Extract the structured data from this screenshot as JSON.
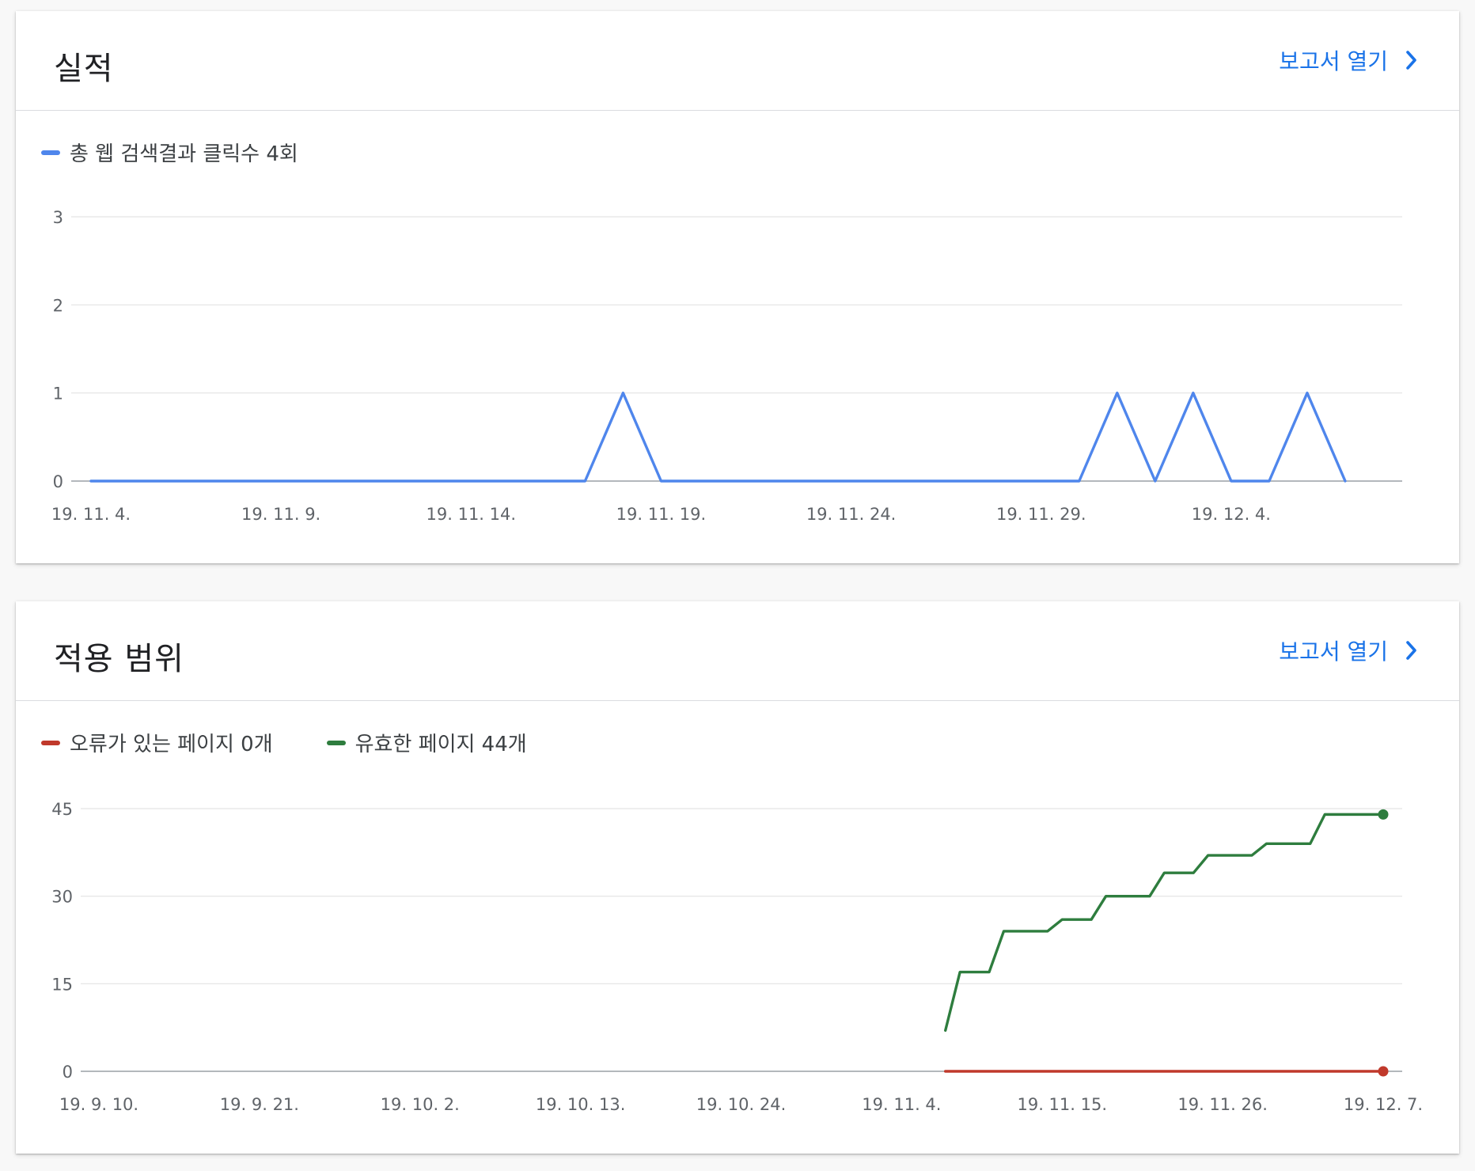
{
  "cards": [
    {
      "title": "실적",
      "link_label": "보고서 열기",
      "legend": [
        {
          "label": "총 웹 검색결과 클릭수 4회",
          "color": "#4f86ec"
        }
      ]
    },
    {
      "title": "적용 범위",
      "link_label": "보고서 열기",
      "legend": [
        {
          "label": "오류가 있는 페이지 0개",
          "color": "#c0392b"
        },
        {
          "label": "유효한 페이지 44개",
          "color": "#2e7d3e"
        }
      ]
    }
  ],
  "chart_data": [
    {
      "type": "line",
      "legend_placement": "top-left",
      "grid": true,
      "ylim": [
        0,
        3
      ],
      "yticks": [
        0,
        1,
        2,
        3
      ],
      "x": [
        "19. 11. 4.",
        "19. 11. 5.",
        "19. 11. 6.",
        "19. 11. 7.",
        "19. 11. 8.",
        "19. 11. 9.",
        "19. 11. 10.",
        "19. 11. 11.",
        "19. 11. 12.",
        "19. 11. 13.",
        "19. 11. 14.",
        "19. 11. 15.",
        "19. 11. 16.",
        "19. 11. 17.",
        "19. 11. 18.",
        "19. 11. 19.",
        "19. 11. 20.",
        "19. 11. 21.",
        "19. 11. 22.",
        "19. 11. 23.",
        "19. 11. 24.",
        "19. 11. 25.",
        "19. 11. 26.",
        "19. 11. 27.",
        "19. 11. 28.",
        "19. 11. 29.",
        "19. 11. 30.",
        "19. 12. 1.",
        "19. 12. 2.",
        "19. 12. 3.",
        "19. 12. 4.",
        "19. 12. 5.",
        "19. 12. 6.",
        "19. 12. 7.",
        "19. 12. 8."
      ],
      "xticks": [
        "19. 11. 4.",
        "19. 11. 9.",
        "19. 11. 14.",
        "19. 11. 19.",
        "19. 11. 24.",
        "19. 11. 29.",
        "19. 12. 4."
      ],
      "series": [
        {
          "name": "총 웹 검색결과 클릭수 4회",
          "color": "#4f86ec",
          "values": [
            0,
            0,
            0,
            0,
            0,
            0,
            0,
            0,
            0,
            0,
            0,
            0,
            0,
            0,
            1,
            0,
            0,
            0,
            0,
            0,
            0,
            0,
            0,
            0,
            0,
            0,
            0,
            1,
            0,
            1,
            0,
            0,
            1,
            0
          ]
        }
      ]
    },
    {
      "type": "line",
      "legend_placement": "top-left",
      "grid": true,
      "ylim": [
        0,
        45
      ],
      "yticks": [
        0,
        15,
        30,
        45
      ],
      "x_range": [
        "19. 9. 10.",
        "19. 12. 7."
      ],
      "xticks": [
        "19. 9. 10.",
        "19. 9. 21.",
        "19. 10. 2.",
        "19. 10. 13.",
        "19. 10. 24.",
        "19. 11. 4.",
        "19. 11. 15.",
        "19. 11. 26.",
        "19. 12. 7."
      ],
      "series": [
        {
          "name": "오류가 있는 페이지 0개",
          "color": "#c0392b",
          "points": [
            [
              "19. 11. 7.",
              0
            ],
            [
              "19. 12. 7.",
              0
            ]
          ]
        },
        {
          "name": "유효한 페이지 44개",
          "color": "#2e7d3e",
          "points": [
            [
              "19. 11. 7.",
              7
            ],
            [
              "19. 11. 8.",
              17
            ],
            [
              "19. 11. 10.",
              17
            ],
            [
              "19. 11. 11.",
              24
            ],
            [
              "19. 11. 14.",
              24
            ],
            [
              "19. 11. 15.",
              26
            ],
            [
              "19. 11. 17.",
              26
            ],
            [
              "19. 11. 18.",
              30
            ],
            [
              "19. 11. 21.",
              30
            ],
            [
              "19. 11. 22.",
              34
            ],
            [
              "19. 11. 24.",
              34
            ],
            [
              "19. 11. 25.",
              37
            ],
            [
              "19. 11. 28.",
              37
            ],
            [
              "19. 11. 29.",
              39
            ],
            [
              "19. 12. 2.",
              39
            ],
            [
              "19. 12. 3.",
              44
            ],
            [
              "19. 12. 7.",
              44
            ]
          ]
        }
      ]
    }
  ]
}
